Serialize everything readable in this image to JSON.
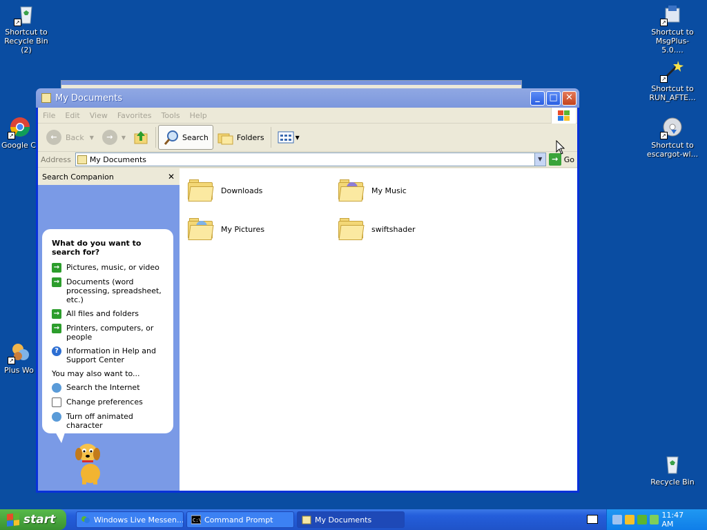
{
  "desktop": {
    "icons": [
      {
        "label": "Shortcut to Recycle Bin (2)",
        "icon": "recycle-bin-icon"
      },
      {
        "label": "Google Ch",
        "icon": "chrome-icon"
      },
      {
        "label": "Plus Wo",
        "icon": "plus-icon"
      },
      {
        "label": "Shortcut to MsgPlus-5.0....",
        "icon": "installer-icon"
      },
      {
        "label": "Shortcut to RUN_AFTE...",
        "icon": "wand-icon"
      },
      {
        "label": "Shortcut to escargot-wl...",
        "icon": "cd-icon"
      },
      {
        "label": "Recycle Bin",
        "icon": "recycle-bin-icon"
      }
    ]
  },
  "window": {
    "title": "My Documents",
    "menu": [
      "File",
      "Edit",
      "View",
      "Favorites",
      "Tools",
      "Help"
    ],
    "toolbar": {
      "back": "Back",
      "search": "Search",
      "folders": "Folders"
    },
    "address": {
      "label": "Address",
      "value": "My Documents",
      "go": "Go"
    },
    "companion": {
      "title": "Search Companion",
      "question": "What do you want to search for?",
      "options": [
        "Pictures, music, or video",
        "Documents (word processing, spreadsheet, etc.)",
        "All files and folders",
        "Printers, computers, or people",
        "Information in Help and Support Center"
      ],
      "also_label": "You may also want to...",
      "also": [
        "Search the Internet",
        "Change preferences",
        "Turn off animated character"
      ]
    },
    "files": [
      {
        "name": "Downloads"
      },
      {
        "name": "My Music"
      },
      {
        "name": "My Pictures"
      },
      {
        "name": "swiftshader"
      }
    ]
  },
  "taskbar": {
    "start": "start",
    "tasks": [
      "Windows Live Messen...",
      "Command Prompt",
      "My Documents"
    ],
    "clock": "11:47 AM"
  },
  "colors": {
    "desktop": "#0a4da2",
    "titlebar": "#7c97dd",
    "taskbar": "#245edb",
    "start": "#3a9231"
  }
}
